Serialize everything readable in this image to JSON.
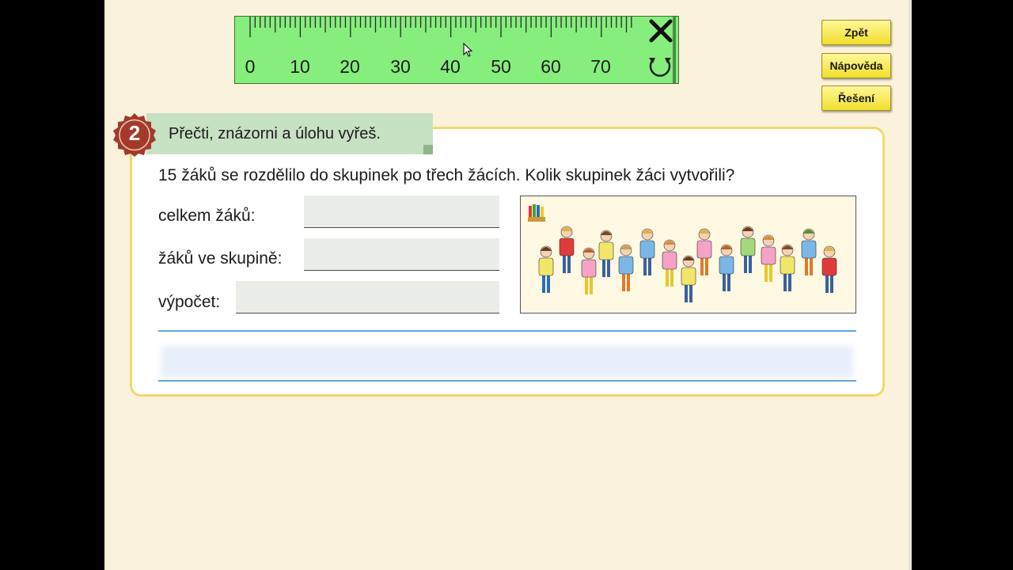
{
  "ruler": {
    "numbers": [
      "0",
      "10",
      "20",
      "30",
      "40",
      "50",
      "60",
      "70"
    ]
  },
  "buttons": {
    "back": "Zpět",
    "help": "Nápověda",
    "solution": "Řešení"
  },
  "task": {
    "number": "2",
    "instruction": "Přečti, znázorni a úlohu vyřeš.",
    "question": "15 žáků se rozdělilo do skupinek po třech žácích. Kolik skupinek žáci vytvořili?",
    "label_total": "celkem žáků:",
    "label_group": "žáků ve skupině:",
    "label_calc": "výpočet:"
  },
  "colors": {
    "ruler": "#86ee7c",
    "button": "#f1df2b",
    "card_border": "#f2d96a",
    "seal": "#a33a2a",
    "answer_line": "#62a7db"
  },
  "icons": {
    "close": "close-icon",
    "rotate": "rotate-icon",
    "crayons": "crayons-icon"
  }
}
